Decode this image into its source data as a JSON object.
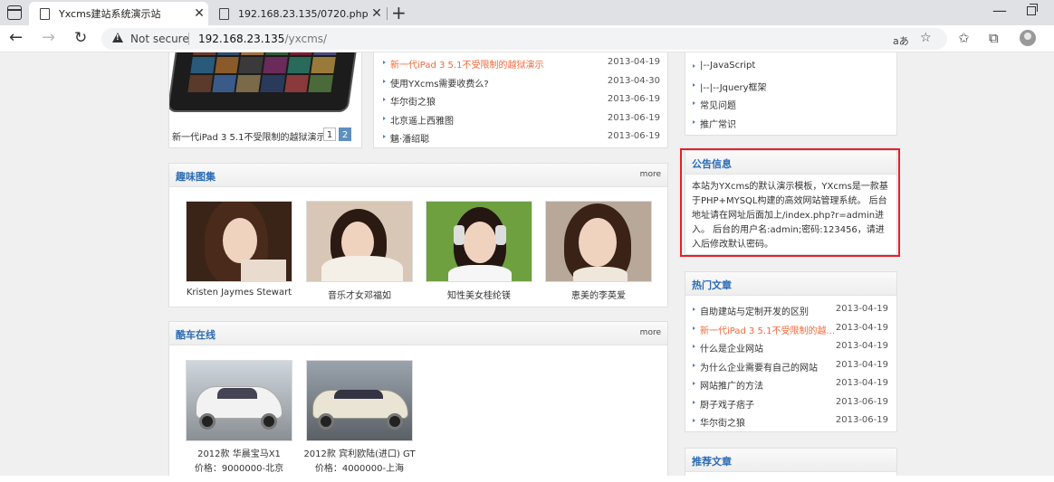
{
  "browser": {
    "tabs": [
      {
        "title": "Yxcms建站系统演示站",
        "active": true
      },
      {
        "title": "192.168.23.135/0720.php",
        "active": false
      }
    ],
    "security_label": "Not secure",
    "url_host": "192.168.23.135",
    "url_path": "/yxcms/",
    "read_aloud_label": "aあ"
  },
  "slideshow": {
    "caption": "新一代iPad 3 5.1不受限制的越狱演示",
    "pages": [
      "1",
      "2"
    ],
    "current_page": 2
  },
  "top_news": [
    {
      "title": "新一代iPad 3 5.1不受限制的越狱演示",
      "date": "2013-04-19",
      "highlight": true
    },
    {
      "title": "使用YXcms需要收费么?",
      "date": "2013-04-30"
    },
    {
      "title": "华尔街之狼",
      "date": "2013-06-19"
    },
    {
      "title": "北京遥上西雅图",
      "date": "2013-06-19"
    },
    {
      "title": "魑·潘绍聪",
      "date": "2013-06-19"
    }
  ],
  "category_tree": [
    {
      "label": "|--JavaScript"
    },
    {
      "label": "|--|--Jquery框架"
    },
    {
      "label": "常见问题"
    },
    {
      "label": "推广常识"
    }
  ],
  "gallery": {
    "title": "趣味图集",
    "more": "more",
    "items": [
      {
        "caption": "Kristen Jaymes Stewart"
      },
      {
        "caption": "音乐才女邓福如"
      },
      {
        "caption": "知性美女桂纶镁"
      },
      {
        "caption": "恵美的李英爱"
      }
    ]
  },
  "cars": {
    "title": "酷车在线",
    "more": "more",
    "items": [
      {
        "name": "2012款 华晨宝马X1",
        "price": "价格：9000000-北京"
      },
      {
        "name": "2012款 宾利欧陆(进口) GT",
        "price": "价格：4000000-上海"
      }
    ]
  },
  "notice": {
    "title": "公告信息",
    "body": "本站为YXcms的默认演示模板，YXcms是一款基于PHP+MYSQL构建的高效网站管理系统。 后台地址请在网址后面加上/index.php?r=admin进入。 后台的用户名:admin;密码:123456，请进入后修改默认密码。"
  },
  "hot_articles": {
    "title": "热门文章",
    "items": [
      {
        "title": "自助建站与定制开发的区别",
        "date": "2013-04-19"
      },
      {
        "title": "新一代iPad 3 5.1不受限制的越...",
        "date": "2013-04-19",
        "highlight": true
      },
      {
        "title": "什么是企业网站",
        "date": "2013-04-19"
      },
      {
        "title": "为什么企业需要有自己的网站",
        "date": "2013-04-19"
      },
      {
        "title": "网站推广的方法",
        "date": "2013-04-19"
      },
      {
        "title": "厨子戏子痞子",
        "date": "2013-06-19"
      },
      {
        "title": "华尔街之狼",
        "date": "2013-06-19"
      }
    ]
  },
  "recommended": {
    "title": "推荐文章"
  },
  "colors": {
    "accent_blue": "#2a6bb3",
    "highlight_orange": "#ef6a3b",
    "notice_border": "#e5202a"
  }
}
